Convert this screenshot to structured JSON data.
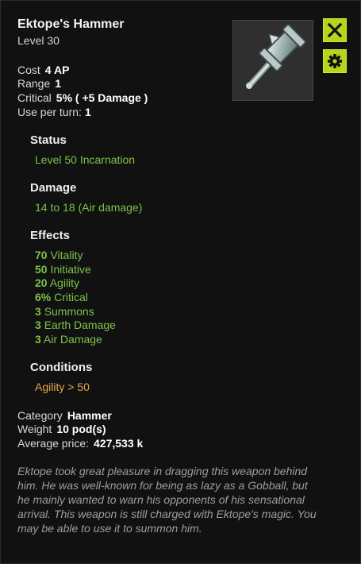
{
  "item": {
    "name": "Ektope's Hammer",
    "level_label": "Level  30"
  },
  "stats": {
    "cost_label": "Cost",
    "cost_value": "4 AP",
    "range_label": "Range",
    "range_value": "1",
    "critical_label": "Critical",
    "critical_value": "5% ( +5 Damage )",
    "use_label": "Use per turn:",
    "use_value": "1"
  },
  "sections": {
    "status_title": "Status",
    "status_value": "Level 50 Incarnation",
    "damage_title": "Damage",
    "damage_value": "14 to 18 (Air damage)",
    "effects_title": "Effects",
    "effects": [
      {
        "num": "70",
        "text": "Vitality"
      },
      {
        "num": "50",
        "text": "Initiative"
      },
      {
        "num": "20",
        "text": "Agility"
      },
      {
        "num": "6%",
        "text": "Critical"
      },
      {
        "num": "3",
        "text": "Summons"
      },
      {
        "num": "3",
        "text": "Earth Damage"
      },
      {
        "num": "3",
        "text": "Air Damage"
      }
    ],
    "conditions_title": "Conditions",
    "conditions_value": "Agility > 50"
  },
  "info": {
    "category_label": "Category",
    "category_value": "Hammer",
    "weight_label": "Weight",
    "weight_value": "10 pod(s)",
    "price_label": "Average price:",
    "price_value": "427,533 k"
  },
  "description": "Ektope took great pleasure in dragging this weapon behind him. He was well-known for being as lazy as a Gobball, but he mainly wanted to warn his opponents of his sensational arrival. This weapon is still charged with Ektope's magic. You may be able to use it to summon him.",
  "icons": {
    "close": "close-icon",
    "settings": "gear-icon",
    "item": "hammer-icon"
  },
  "colors": {
    "accent": "#b7d51d",
    "effect_green": "#7cc24a",
    "condition_orange": "#e8a449"
  }
}
